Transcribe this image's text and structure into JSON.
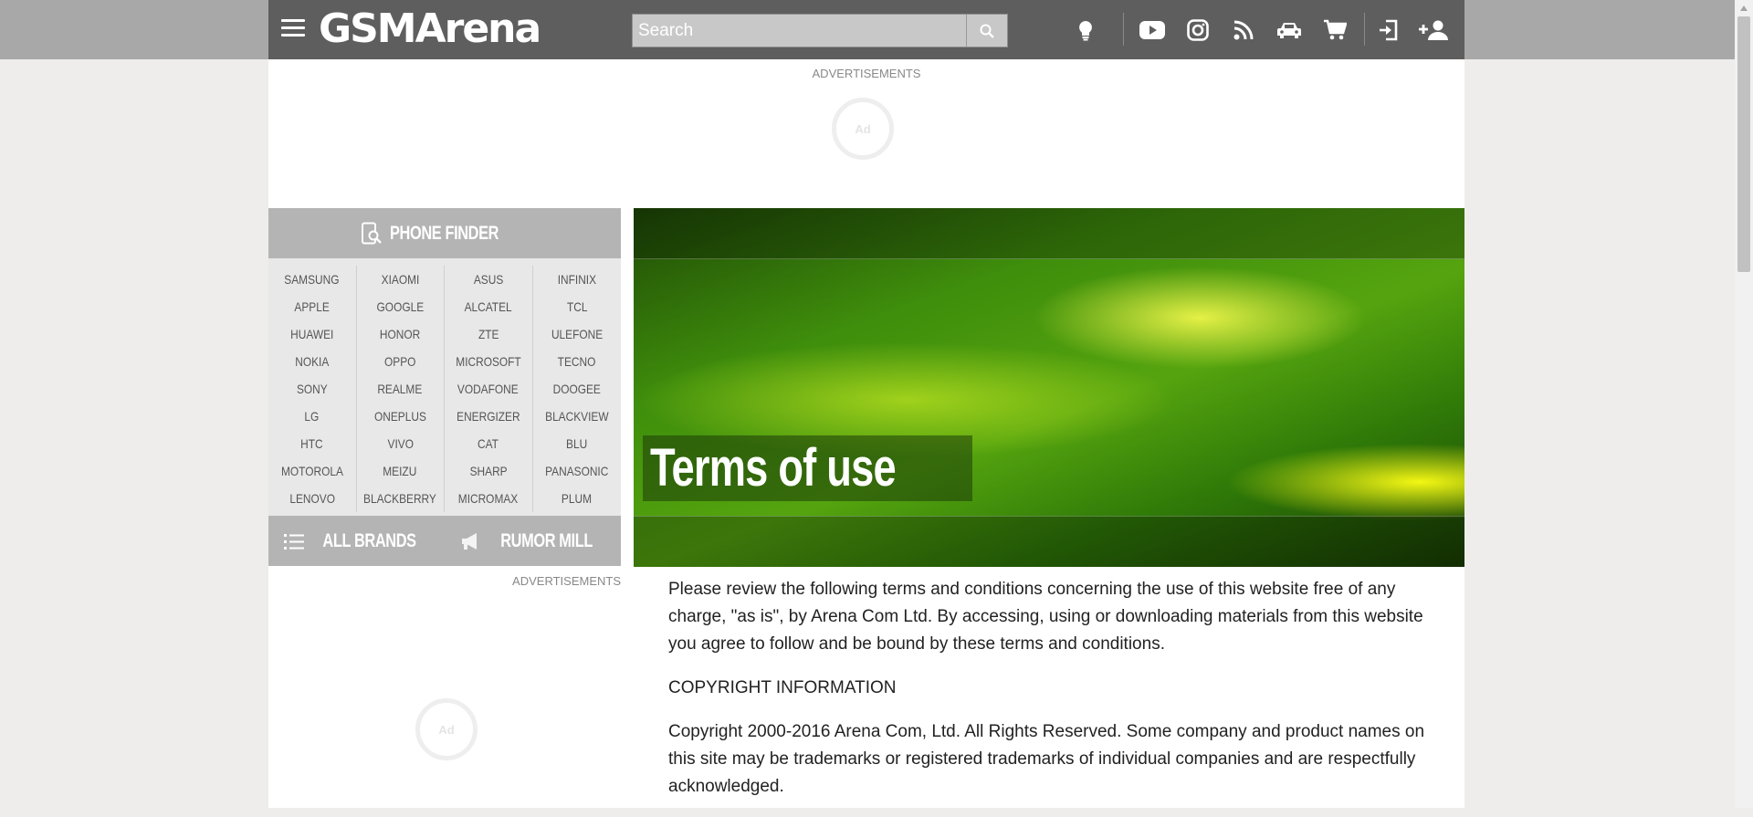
{
  "header": {
    "logo": "GSMArena",
    "search_placeholder": "Search"
  },
  "icons": [
    "menu-icon",
    "search-icon",
    "lightbulb-icon",
    "youtube-icon",
    "instagram-icon",
    "rss-icon",
    "car-icon",
    "cart-icon",
    "login-icon",
    "add-user-icon"
  ],
  "ads": {
    "top_label": "ADVERTISEMENTS",
    "side_label": "ADVERTISEMENTS",
    "spinner_text": "Ad"
  },
  "sidebar": {
    "phone_finder": "PHONE FINDER",
    "brand_columns": [
      [
        "SAMSUNG",
        "APPLE",
        "HUAWEI",
        "NOKIA",
        "SONY",
        "LG",
        "HTC",
        "MOTOROLA",
        "LENOVO"
      ],
      [
        "XIAOMI",
        "GOOGLE",
        "HONOR",
        "OPPO",
        "REALME",
        "ONEPLUS",
        "VIVO",
        "MEIZU",
        "BLACKBERRY"
      ],
      [
        "ASUS",
        "ALCATEL",
        "ZTE",
        "MICROSOFT",
        "VODAFONE",
        "ENERGIZER",
        "CAT",
        "SHARP",
        "MICROMAX"
      ],
      [
        "INFINIX",
        "TCL",
        "ULEFONE",
        "TECNO",
        "DOOGEE",
        "BLACKVIEW",
        "BLU",
        "PANASONIC",
        "PLUM"
      ]
    ],
    "all_brands": "ALL BRANDS",
    "rumor_mill": "RUMOR MILL"
  },
  "main": {
    "title": "Terms of use",
    "paragraphs": [
      "Please review the following terms and conditions concerning the use of this website free of any charge, \"as is\", by Arena Com Ltd. By accessing, using or downloading materials from this website you agree to follow and be bound by these terms and conditions.",
      "COPYRIGHT INFORMATION",
      "Copyright 2000-2016 Arena Com, Ltd. All Rights Reserved. Some company and product names on this site may be trademarks or registered trademarks of individual companies and are respectfully acknowledged."
    ]
  },
  "colors": {
    "header_bg": "#5e5e5e",
    "header_band": "#a8a8a8",
    "page_bg": "#efedeb",
    "sidebar_head": "#b4b4b4",
    "brand_bg": "#e8e8e8",
    "hero_green": "#3f8e0c"
  }
}
